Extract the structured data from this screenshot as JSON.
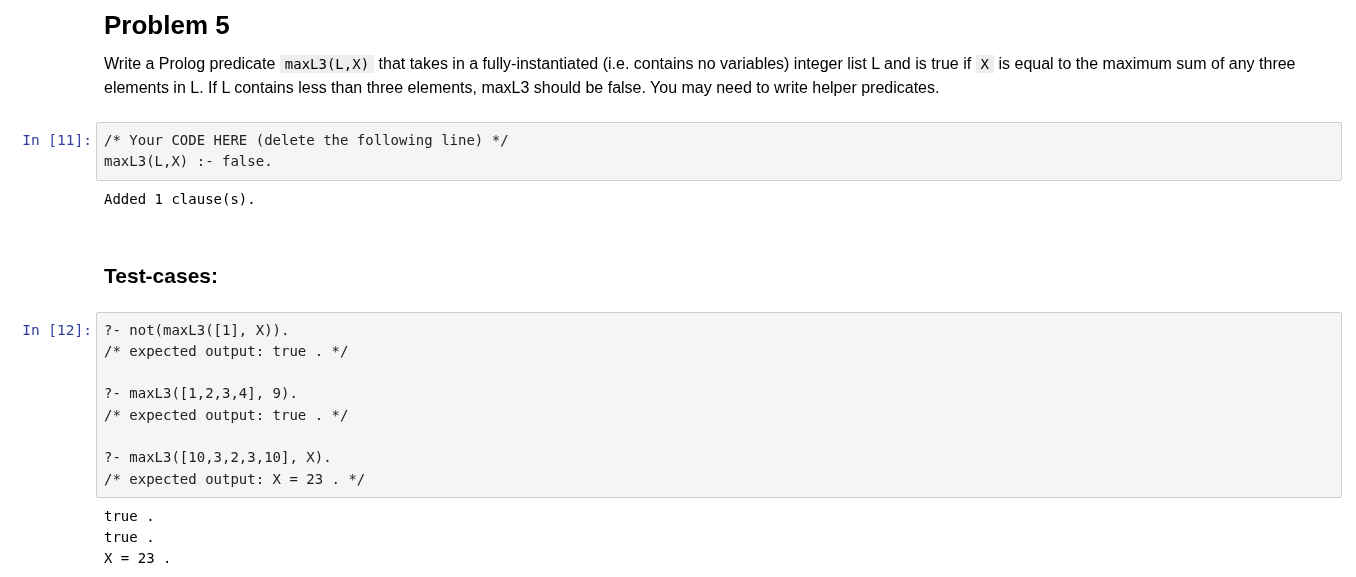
{
  "cells": [
    {
      "kind": "title",
      "text": "Problem 5"
    },
    {
      "kind": "paragraph",
      "parts": [
        {
          "kind": "text",
          "text": "Write a Prolog predicate "
        },
        {
          "kind": "code",
          "text": "maxL3(L,X)"
        },
        {
          "kind": "text",
          "text": " that takes in a fully-instantiated (i.e. contains no variables) integer list L and is true if "
        },
        {
          "kind": "code",
          "text": "X"
        },
        {
          "kind": "text",
          "text": " is equal to the maximum sum of any three elements in L. If L contains less than three elements, maxL3 should be false. You may need to write helper predicates."
        }
      ]
    },
    {
      "kind": "code",
      "prompt": "In [11]:",
      "groups": [
        [
          "/* Your CODE HERE (delete the following line) */",
          "maxL3(L,X) :- false."
        ]
      ],
      "output": [
        "Added 1 clause(s)."
      ]
    },
    {
      "kind": "subheading",
      "text": "Test-cases:"
    },
    {
      "kind": "code",
      "prompt": "In [12]:",
      "groups": [
        [
          "?- not(maxL3([1], X)).",
          "/* expected output: true . */"
        ],
        [
          "?- maxL3([1,2,3,4], 9).",
          "/* expected output: true . */"
        ],
        [
          "?- maxL3([10,3,2,3,10], X).",
          "/* expected output: X = 23 . */"
        ]
      ],
      "output": [
        "true .",
        "true .",
        "X = 23 ."
      ]
    }
  ]
}
